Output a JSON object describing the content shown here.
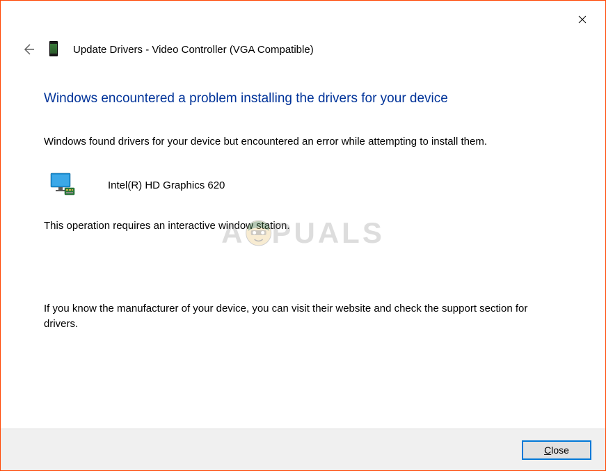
{
  "header": {
    "title": "Update Drivers - Video Controller (VGA Compatible)"
  },
  "main": {
    "heading": "Windows encountered a problem installing the drivers for your device",
    "found_text": "Windows found drivers for your device but encountered an error while attempting to install them.",
    "device_name": "Intel(R) HD Graphics 620",
    "error_message": "This operation requires an interactive window station.",
    "help_text": "If you know the manufacturer of your device, you can visit their website and check the support section for drivers."
  },
  "footer": {
    "close_label": "Close"
  },
  "watermark": {
    "left": "A",
    "right": "PUALS"
  }
}
